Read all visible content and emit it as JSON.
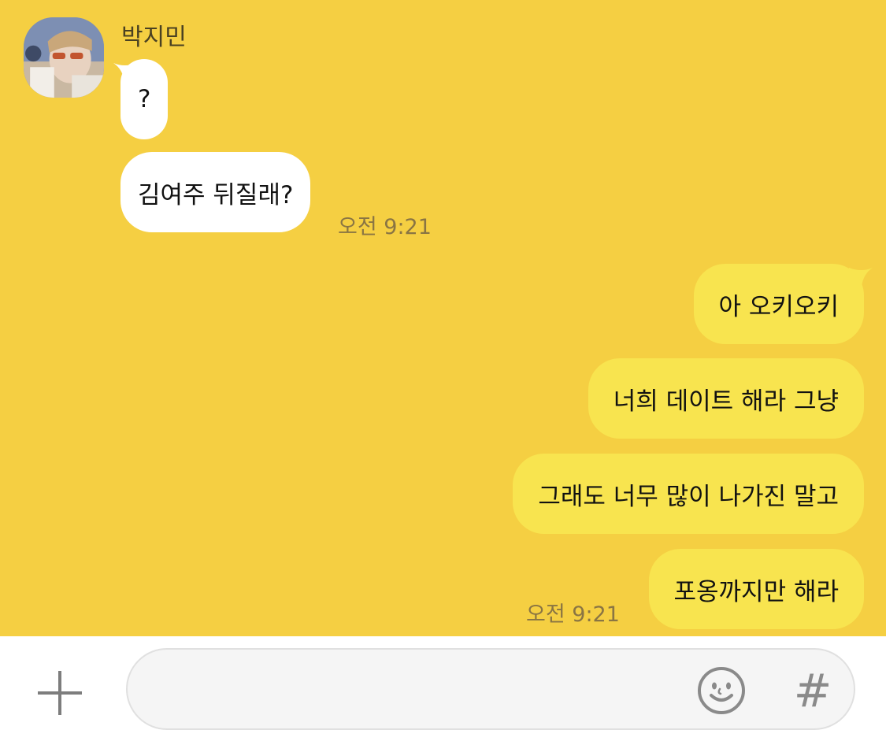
{
  "chat": {
    "sender": {
      "name": "박지민"
    },
    "incoming": [
      {
        "text": "?"
      },
      {
        "text": "김여주 뒤질래?"
      }
    ],
    "incoming_time": "오전 9:21",
    "outgoing": [
      {
        "text": "아 오키오키"
      },
      {
        "text": "너희 데이트 해라 그냥"
      },
      {
        "text": "그래도 너무 많이 나가진 말고"
      },
      {
        "text": "포옹까지만 해라"
      }
    ],
    "outgoing_time": "오전 9:21"
  },
  "input_bar": {
    "add_icon": "plus-icon",
    "message_placeholder": "",
    "emoji_icon": "smiley-icon",
    "hashtag_label": "#"
  },
  "colors": {
    "chat_background": "#f5cf42",
    "incoming_bubble": "#ffffff",
    "outgoing_bubble": "#f8e44f",
    "timestamp": "#8a7543"
  }
}
